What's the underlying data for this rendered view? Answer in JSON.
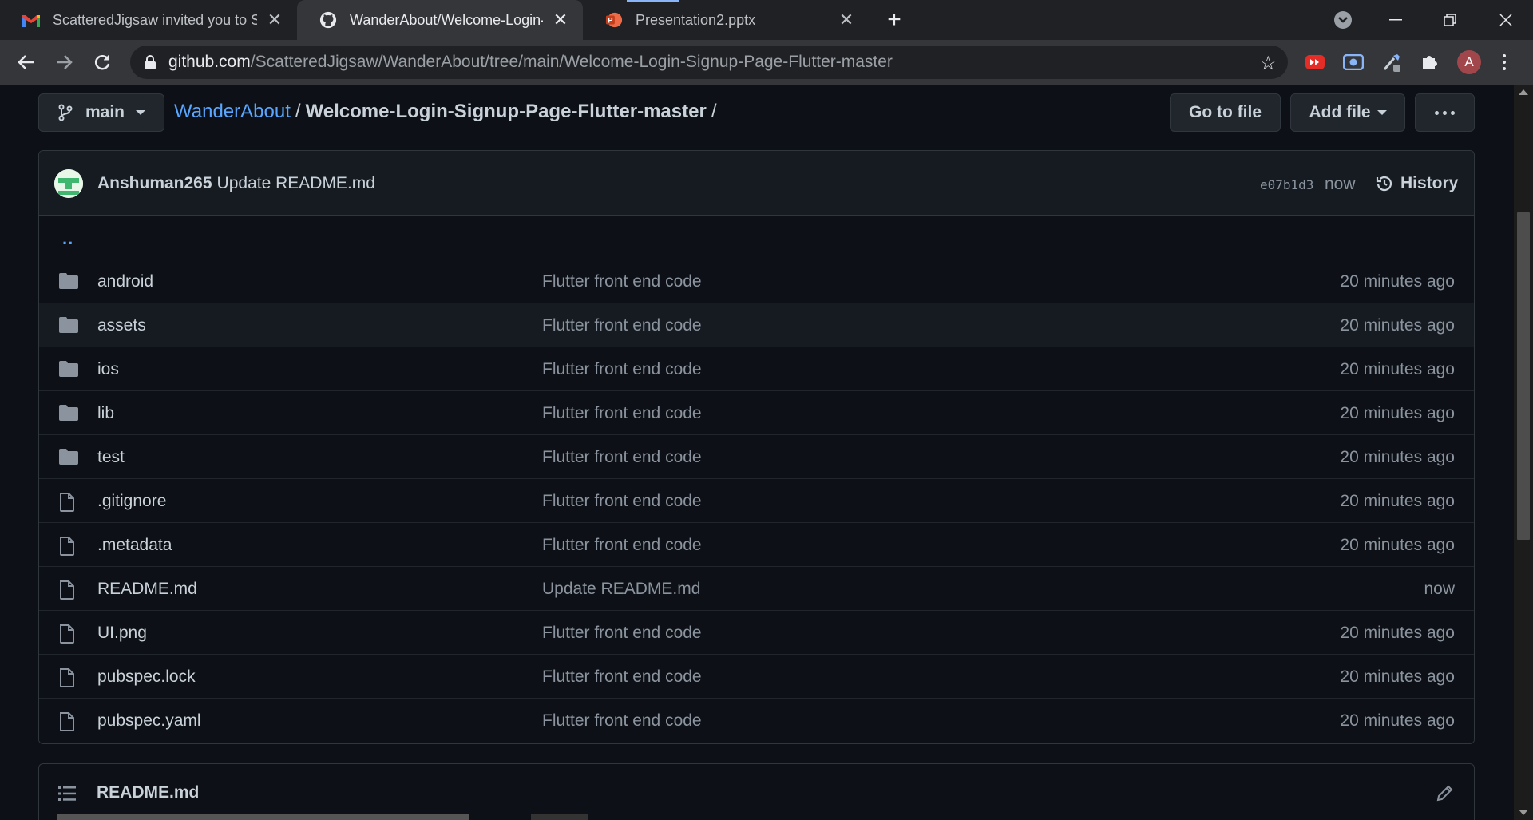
{
  "browser": {
    "tabs": [
      {
        "title": "ScatteredJigsaw invited you to Sc",
        "icon": "gmail-icon",
        "active": false
      },
      {
        "title": "WanderAbout/Welcome-Login-Si",
        "icon": "github-icon",
        "active": true
      },
      {
        "title": "Presentation2.pptx",
        "icon": "powerpoint-icon",
        "active": false
      }
    ],
    "url_host": "github.com",
    "url_path": "/ScatteredJigsaw/WanderAbout/tree/main/Welcome-Login-Signup-Page-Flutter-master",
    "profile_initial": "A"
  },
  "repo": {
    "branch": "main",
    "repo_name": "WanderAbout",
    "path_separator": "/",
    "directory": "Welcome-Login-Signup-Page-Flutter-master",
    "trailing_separator": "/",
    "go_to_file": "Go to file",
    "add_file": "Add file"
  },
  "commit": {
    "author": "Anshuman265",
    "message": "Update README.md",
    "sha": "e07b1d3",
    "when": "now",
    "history": "History"
  },
  "parent_dir": "..",
  "files": [
    {
      "name": "android",
      "type": "folder",
      "message": "Flutter front end code",
      "age": "20 minutes ago"
    },
    {
      "name": "assets",
      "type": "folder",
      "message": "Flutter front end code",
      "age": "20 minutes ago"
    },
    {
      "name": "ios",
      "type": "folder",
      "message": "Flutter front end code",
      "age": "20 minutes ago"
    },
    {
      "name": "lib",
      "type": "folder",
      "message": "Flutter front end code",
      "age": "20 minutes ago"
    },
    {
      "name": "test",
      "type": "folder",
      "message": "Flutter front end code",
      "age": "20 minutes ago"
    },
    {
      "name": ".gitignore",
      "type": "file",
      "message": "Flutter front end code",
      "age": "20 minutes ago"
    },
    {
      "name": ".metadata",
      "type": "file",
      "message": "Flutter front end code",
      "age": "20 minutes ago"
    },
    {
      "name": "README.md",
      "type": "file",
      "message": "Update README.md",
      "age": "now"
    },
    {
      "name": "UI.png",
      "type": "file",
      "message": "Flutter front end code",
      "age": "20 minutes ago"
    },
    {
      "name": "pubspec.lock",
      "type": "file",
      "message": "Flutter front end code",
      "age": "20 minutes ago"
    },
    {
      "name": "pubspec.yaml",
      "type": "file",
      "message": "Flutter front end code",
      "age": "20 minutes ago"
    }
  ],
  "readme": {
    "title": "README.md"
  },
  "colors": {
    "link": "#58a6ff",
    "background": "#0d1117",
    "folder": "#8b949e"
  }
}
